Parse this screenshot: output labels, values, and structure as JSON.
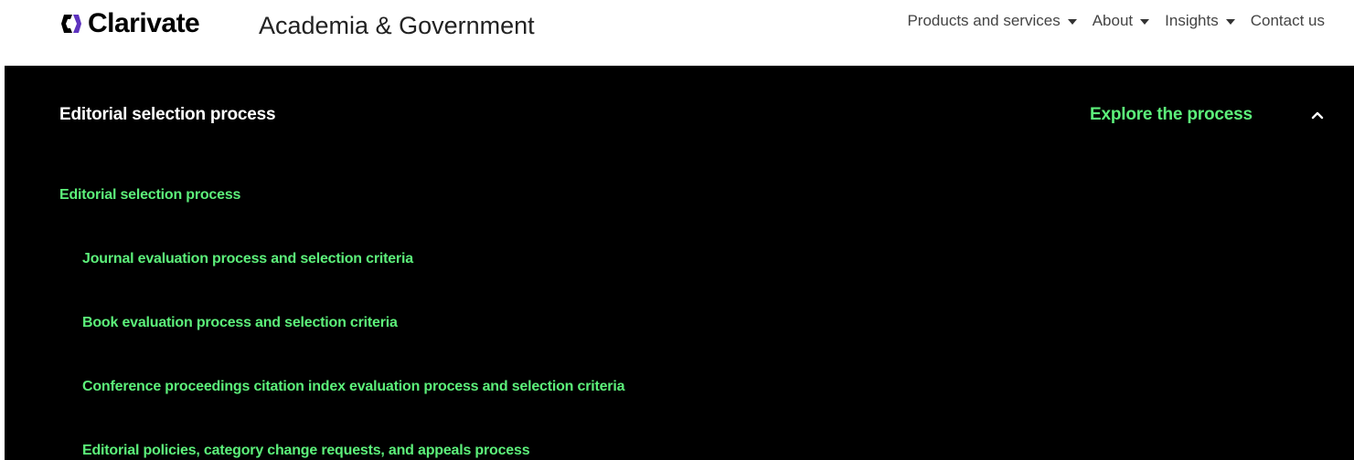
{
  "header": {
    "logo_text": "Clarivate",
    "section_title": "Academia & Government",
    "nav": [
      {
        "label": "Products and services",
        "has_dropdown": true
      },
      {
        "label": "About",
        "has_dropdown": true
      },
      {
        "label": "Insights",
        "has_dropdown": true
      },
      {
        "label": "Contact us",
        "has_dropdown": false
      }
    ]
  },
  "panel": {
    "heading": "Editorial selection process",
    "explore_label": "Explore the process",
    "toggle_icon": "chevron-up-icon",
    "links": [
      {
        "label": "Editorial selection process",
        "level": 0
      },
      {
        "label": "Journal evaluation process and selection criteria",
        "level": 1
      },
      {
        "label": "Book evaluation process and selection criteria",
        "level": 1
      },
      {
        "label": "Conference proceedings citation index evaluation process and selection criteria",
        "level": 1
      },
      {
        "label": "Editorial policies, category change requests, and appeals process",
        "level": 1
      }
    ]
  },
  "colors": {
    "accent_green": "#5cf07a",
    "panel_bg": "#000000",
    "header_bg": "#ffffff",
    "logo_purple": "#5e33bf"
  }
}
